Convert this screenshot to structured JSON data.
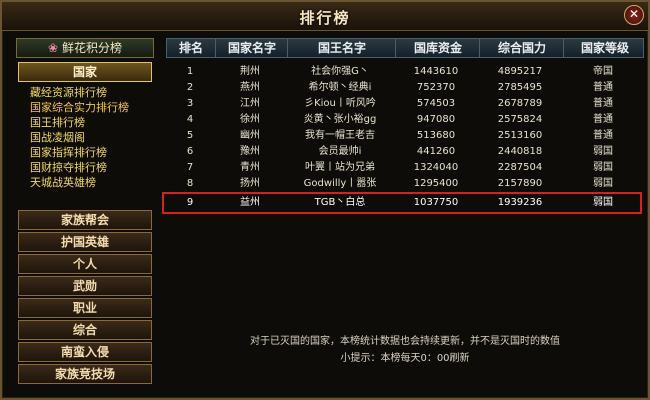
{
  "window": {
    "title": "排行榜",
    "close_label": "✕"
  },
  "sidebar": {
    "flower_tab": "鲜花积分榜",
    "nation_button": "国家",
    "sub_items": [
      "藏经资源排行榜",
      "国家综合实力排行榜",
      "国王排行榜",
      "国战凌烟阁",
      "国家指挥排行榜",
      "国财掠夺排行榜",
      "天城战英雄榜"
    ],
    "buttons": [
      "家族帮会",
      "护国英雄",
      "个人",
      "武勋",
      "职业",
      "综合",
      "南蛮入侵",
      "家族竞技场"
    ]
  },
  "table": {
    "headers": [
      "排名",
      "国家名字",
      "国王名字",
      "国库资金",
      "综合国力",
      "国家等级"
    ],
    "rows": [
      [
        "1",
        "荆州",
        "社会你强G丶",
        "1443610",
        "4895217",
        "帝国"
      ],
      [
        "2",
        "燕州",
        "希尔顿丶经典i",
        "752370",
        "2785495",
        "普通"
      ],
      [
        "3",
        "江州",
        "彡Kiou丨听风吟",
        "574503",
        "2678789",
        "普通"
      ],
      [
        "4",
        "徐州",
        "炎黄丶张小裕gg",
        "947080",
        "2575824",
        "普通"
      ],
      [
        "5",
        "幽州",
        "我有一帽王老吉",
        "513680",
        "2513160",
        "普通"
      ],
      [
        "6",
        "豫州",
        "会员最帅i",
        "441260",
        "2440818",
        "弱国"
      ],
      [
        "7",
        "青州",
        "叶翼丨站为兄弟",
        "1324040",
        "2287504",
        "弱国"
      ],
      [
        "8",
        "扬州",
        "Godwilly丨嚣张",
        "1295400",
        "2157890",
        "弱国"
      ],
      [
        "9",
        "益州",
        "TGB丶白总",
        "1037750",
        "1939236",
        "弱国"
      ]
    ],
    "selected_index": 8
  },
  "notes": {
    "line1": "对于已灭国的国家，本榜统计数据也会持续更新，并不是灭国时的数值",
    "line2": "小提示：本榜每天0：00刷新"
  },
  "colors": {
    "highlight": "#d32222",
    "accent": "#e3c26a"
  }
}
